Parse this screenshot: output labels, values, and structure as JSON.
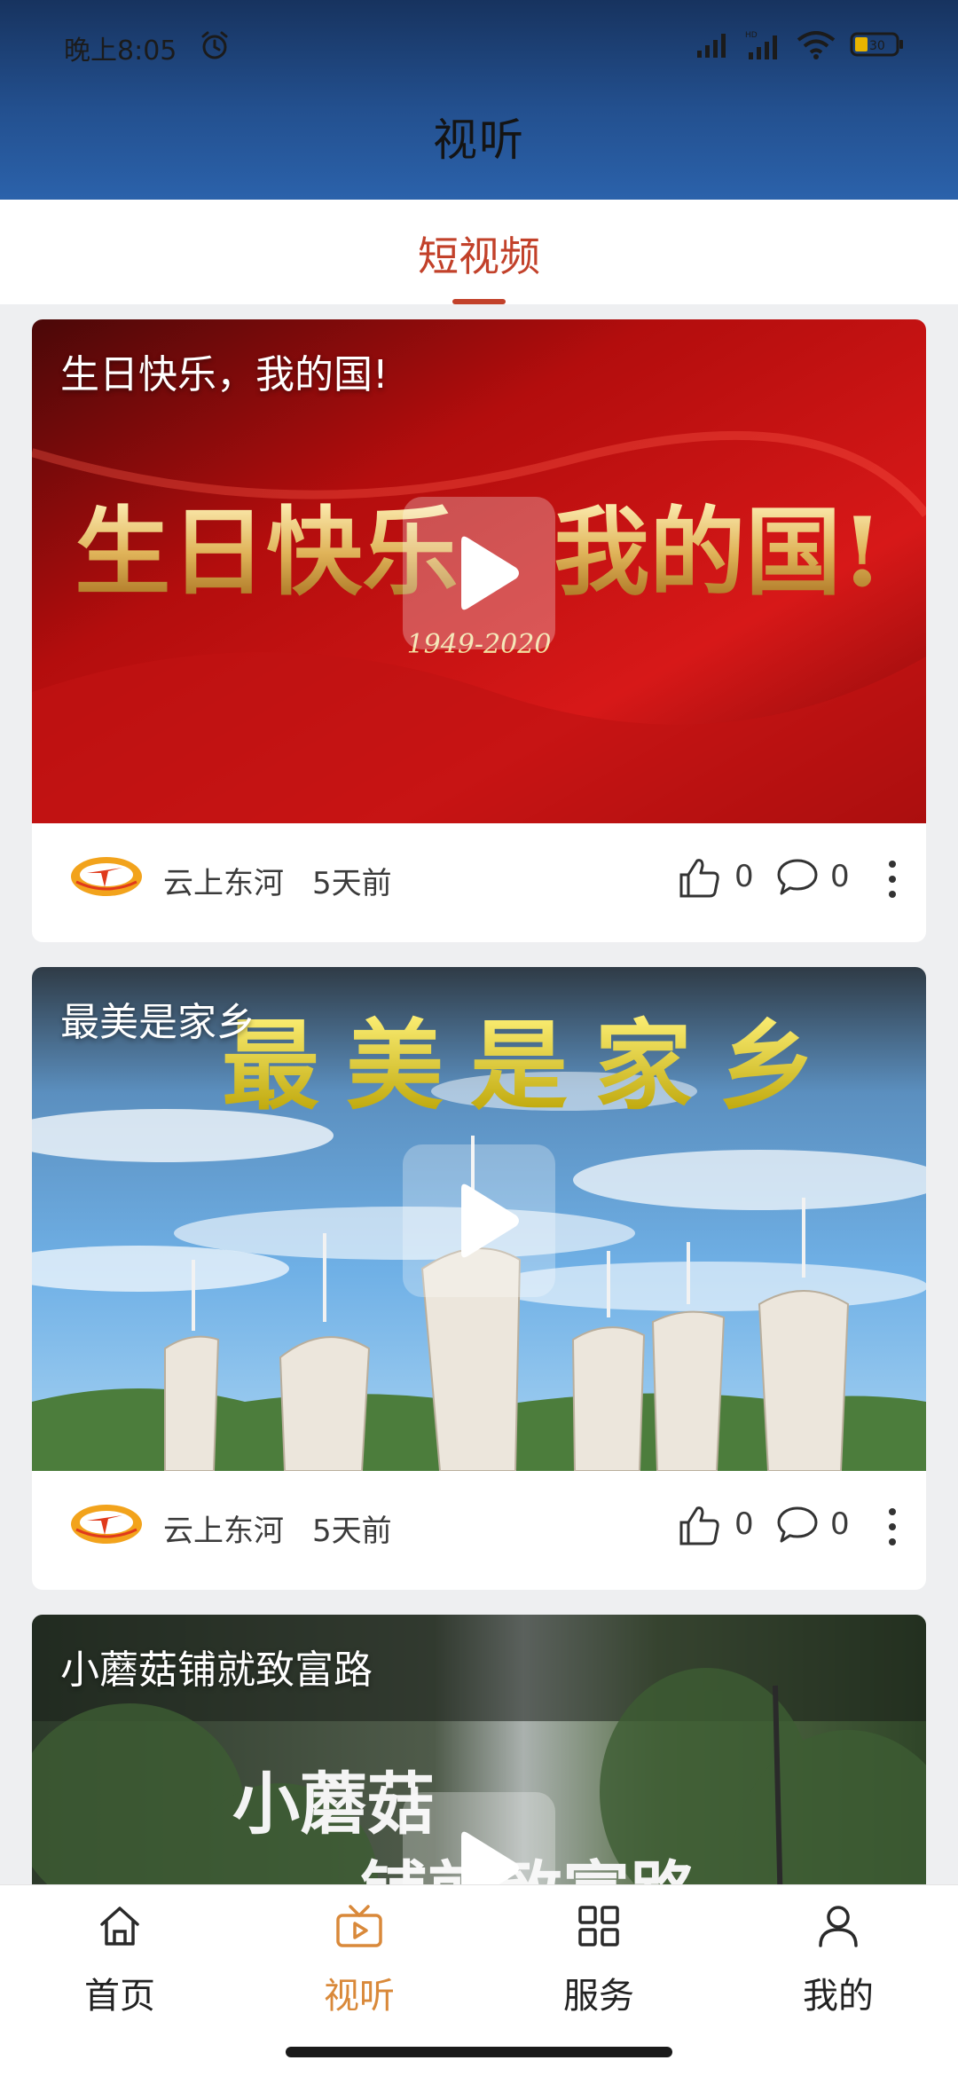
{
  "status_bar": {
    "time": "晚上8:05",
    "battery": "30"
  },
  "header": {
    "title": "视听"
  },
  "tabs": [
    {
      "label": "短视频",
      "active": true
    }
  ],
  "videos": [
    {
      "title": "生日快乐，我的国!",
      "overlay_text": "生日快乐，我的国!",
      "overlay_subtext": "1949-2020",
      "source": "云上东河",
      "time_ago": "5天前",
      "likes": "0",
      "comments": "0"
    },
    {
      "title": "最美是家乡",
      "overlay_text": "最美是家乡",
      "source": "云上东河",
      "time_ago": "5天前",
      "likes": "0",
      "comments": "0"
    },
    {
      "title": "小蘑菇铺就致富路",
      "overlay_text": "小蘑菇",
      "overlay_subtext": "铺就致富路"
    }
  ],
  "bottom_nav": [
    {
      "label": "首页",
      "icon": "home-icon",
      "active": false
    },
    {
      "label": "视听",
      "icon": "video-icon",
      "active": true
    },
    {
      "label": "服务",
      "icon": "grid-icon",
      "active": false
    },
    {
      "label": "我的",
      "icon": "person-icon",
      "active": false
    }
  ],
  "colors": {
    "accent": "#c2412a",
    "nav_active": "#d9893a",
    "header_top": "#17335f",
    "header_bottom": "#2b62ab"
  }
}
